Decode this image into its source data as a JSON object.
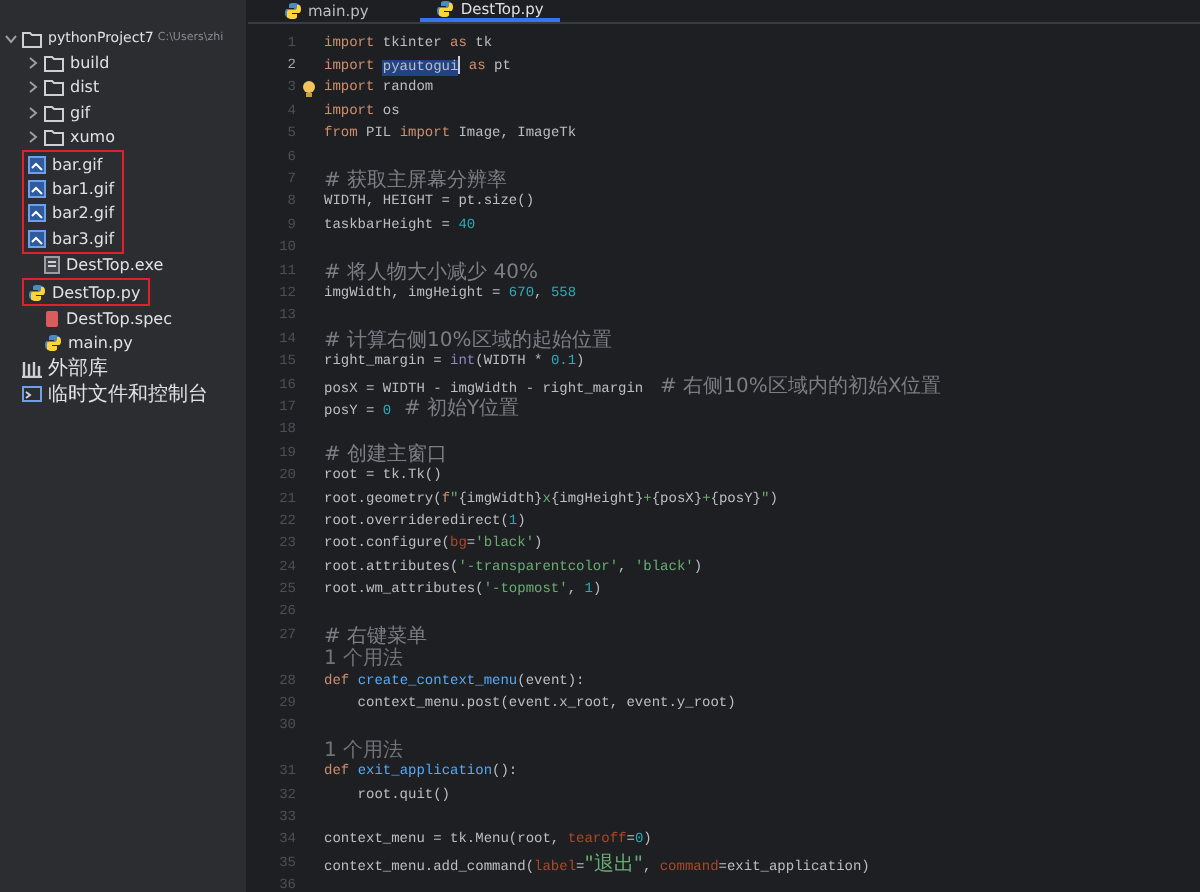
{
  "sidebar": {
    "tree": [
      {
        "kind": "project",
        "label": "pythonProject7",
        "path": "C:\\Users\\zhi",
        "expanded": true,
        "children": [
          {
            "kind": "folder",
            "label": "build",
            "expanded": false
          },
          {
            "kind": "folder",
            "label": "dist",
            "expanded": false
          },
          {
            "kind": "folder",
            "label": "gif",
            "expanded": false
          },
          {
            "kind": "folder",
            "label": "xumo",
            "expanded": false
          },
          {
            "kind": "highlight-box",
            "children": [
              {
                "kind": "gif",
                "label": "bar.gif"
              },
              {
                "kind": "gif",
                "label": "bar1.gif"
              },
              {
                "kind": "gif",
                "label": "bar2.gif"
              },
              {
                "kind": "gif",
                "label": "bar3.gif"
              }
            ]
          },
          {
            "kind": "exe",
            "label": "DestTop.exe"
          },
          {
            "kind": "highlight-box",
            "children": [
              {
                "kind": "python",
                "label": "DestTop.py"
              }
            ]
          },
          {
            "kind": "spec",
            "label": "DestTop.spec"
          },
          {
            "kind": "python",
            "label": "main.py"
          }
        ]
      },
      {
        "kind": "libraries",
        "label": "外部库"
      },
      {
        "kind": "scratches",
        "label": "临时文件和控制台"
      }
    ]
  },
  "tabs": [
    {
      "label": "main.py",
      "selected": false
    },
    {
      "label": "DestTop.py",
      "selected": true
    }
  ],
  "editor": {
    "lines": [
      {
        "kind": "code",
        "number": "1",
        "current": false,
        "tokens": [
          {
            "kind": "keyword",
            "text": "import "
          },
          {
            "kind": "plain",
            "text": "tkinter "
          },
          {
            "kind": "keyword",
            "text": "as "
          },
          {
            "kind": "plain",
            "text": "tk"
          }
        ]
      },
      {
        "kind": "code",
        "number": "2",
        "current": true,
        "tokens": [
          {
            "kind": "keyword",
            "text": "import "
          },
          {
            "kind": "selected",
            "text": "pyautogui"
          },
          {
            "kind": "keyword",
            "text": " as "
          },
          {
            "kind": "plain",
            "text": "pt"
          }
        ]
      },
      {
        "kind": "code",
        "number": "3",
        "current": false,
        "bulb": true,
        "tokens": [
          {
            "kind": "keyword",
            "text": "import "
          },
          {
            "kind": "plain",
            "text": "random"
          }
        ]
      },
      {
        "kind": "code",
        "number": "4",
        "current": false,
        "tokens": [
          {
            "kind": "keyword",
            "text": "import "
          },
          {
            "kind": "plain",
            "text": "os"
          }
        ]
      },
      {
        "kind": "code",
        "number": "5",
        "current": false,
        "tokens": [
          {
            "kind": "keyword",
            "text": "from "
          },
          {
            "kind": "plain",
            "text": "PIL "
          },
          {
            "kind": "keyword",
            "text": "import "
          },
          {
            "kind": "plain",
            "text": "Image, ImageTk"
          }
        ]
      },
      {
        "kind": "code",
        "number": "6",
        "current": false
      },
      {
        "kind": "code",
        "number": "7",
        "current": false,
        "tokens": [
          {
            "kind": "comment",
            "text": "# 获取主屏幕分辨率"
          }
        ]
      },
      {
        "kind": "code",
        "number": "8",
        "current": false,
        "tokens": [
          {
            "kind": "plain",
            "text": "WIDTH, HEIGHT = pt.size()"
          }
        ]
      },
      {
        "kind": "code",
        "number": "9",
        "current": false,
        "tokens": [
          {
            "kind": "plain",
            "text": "taskbarHeight = "
          },
          {
            "kind": "number",
            "text": "40"
          }
        ]
      },
      {
        "kind": "code",
        "number": "10",
        "current": false
      },
      {
        "kind": "code",
        "number": "11",
        "current": false,
        "tokens": [
          {
            "kind": "comment",
            "text": "# 将人物大小减少 40%"
          }
        ]
      },
      {
        "kind": "code",
        "number": "12",
        "current": false,
        "tokens": [
          {
            "kind": "plain",
            "text": "imgWidth, imgHeight = "
          },
          {
            "kind": "number",
            "text": "670"
          },
          {
            "kind": "plain",
            "text": ", "
          },
          {
            "kind": "number",
            "text": "558"
          }
        ]
      },
      {
        "kind": "code",
        "number": "13",
        "current": false
      },
      {
        "kind": "code",
        "number": "14",
        "current": false,
        "tokens": [
          {
            "kind": "comment",
            "text": "# 计算右侧10%区域的起始位置"
          }
        ]
      },
      {
        "kind": "code",
        "number": "15",
        "current": false,
        "tokens": [
          {
            "kind": "plain",
            "text": "right_margin = "
          },
          {
            "kind": "builtin",
            "text": "int"
          },
          {
            "kind": "plain",
            "text": "(WIDTH * "
          },
          {
            "kind": "number",
            "text": "0.1"
          },
          {
            "kind": "plain",
            "text": ")"
          }
        ]
      },
      {
        "kind": "code",
        "number": "16",
        "current": false,
        "tokens": [
          {
            "kind": "plain",
            "text": "posX = WIDTH - imgWidth - right_margin  "
          },
          {
            "kind": "comment",
            "text": "# 右侧10%区域内的初始X位置"
          }
        ]
      },
      {
        "kind": "code",
        "number": "17",
        "current": false,
        "tokens": [
          {
            "kind": "plain",
            "text": "posY = "
          },
          {
            "kind": "number",
            "text": "0"
          },
          {
            "kind": "comment",
            "text": "  # 初始Y位置"
          }
        ]
      },
      {
        "kind": "code",
        "number": "18",
        "current": false
      },
      {
        "kind": "code",
        "number": "19",
        "current": false,
        "tokens": [
          {
            "kind": "comment",
            "text": "# 创建主窗口"
          }
        ]
      },
      {
        "kind": "code",
        "number": "20",
        "current": false,
        "tokens": [
          {
            "kind": "plain",
            "text": "root = tk.Tk()"
          }
        ]
      },
      {
        "kind": "code",
        "number": "21",
        "current": false,
        "tokens": [
          {
            "kind": "plain",
            "text": "root.geometry("
          },
          {
            "kind": "keyword",
            "text": "f"
          },
          {
            "kind": "string",
            "text": "\""
          },
          {
            "kind": "plain",
            "text": "{imgWidth}"
          },
          {
            "kind": "string",
            "text": "x"
          },
          {
            "kind": "plain",
            "text": "{imgHeight}"
          },
          {
            "kind": "string",
            "text": "+"
          },
          {
            "kind": "plain",
            "text": "{posX}"
          },
          {
            "kind": "string",
            "text": "+"
          },
          {
            "kind": "plain",
            "text": "{posY}"
          },
          {
            "kind": "string",
            "text": "\""
          },
          {
            "kind": "plain",
            "text": ")"
          }
        ]
      },
      {
        "kind": "code",
        "number": "22",
        "current": false,
        "tokens": [
          {
            "kind": "plain",
            "text": "root.overrideredirect("
          },
          {
            "kind": "number",
            "text": "1"
          },
          {
            "kind": "plain",
            "text": ")"
          }
        ]
      },
      {
        "kind": "code",
        "number": "23",
        "current": false,
        "tokens": [
          {
            "kind": "plain",
            "text": "root.configure("
          },
          {
            "kind": "param",
            "text": "bg"
          },
          {
            "kind": "plain",
            "text": "="
          },
          {
            "kind": "string",
            "text": "'black'"
          },
          {
            "kind": "plain",
            "text": ")"
          }
        ]
      },
      {
        "kind": "code",
        "number": "24",
        "current": false,
        "tokens": [
          {
            "kind": "plain",
            "text": "root.attributes("
          },
          {
            "kind": "string",
            "text": "'-transparentcolor'"
          },
          {
            "kind": "plain",
            "text": ", "
          },
          {
            "kind": "string",
            "text": "'black'"
          },
          {
            "kind": "plain",
            "text": ")"
          }
        ]
      },
      {
        "kind": "code",
        "number": "25",
        "current": false,
        "tokens": [
          {
            "kind": "plain",
            "text": "root.wm_attributes("
          },
          {
            "kind": "string",
            "text": "'-topmost'"
          },
          {
            "kind": "plain",
            "text": ", "
          },
          {
            "kind": "number",
            "text": "1"
          },
          {
            "kind": "plain",
            "text": ")"
          }
        ]
      },
      {
        "kind": "code",
        "number": "26",
        "current": false
      },
      {
        "kind": "code",
        "number": "27",
        "current": false,
        "tokens": [
          {
            "kind": "comment",
            "text": "# 右键菜单"
          }
        ]
      },
      {
        "kind": "hint",
        "text": "1 个用法"
      },
      {
        "kind": "code",
        "number": "28",
        "current": false,
        "tokens": [
          {
            "kind": "keyword",
            "text": "def "
          },
          {
            "kind": "funcdef",
            "text": "create_context_menu"
          },
          {
            "kind": "plain",
            "text": "(event):"
          }
        ]
      },
      {
        "kind": "code",
        "number": "29",
        "current": false,
        "tokens": [
          {
            "kind": "plain",
            "text": "    context_menu.post(event.x_root, event.y_root)"
          }
        ]
      },
      {
        "kind": "code",
        "number": "30",
        "current": false
      },
      {
        "kind": "hint",
        "text": "1 个用法"
      },
      {
        "kind": "code",
        "number": "31",
        "current": false,
        "tokens": [
          {
            "kind": "keyword",
            "text": "def "
          },
          {
            "kind": "funcdef",
            "text": "exit_application"
          },
          {
            "kind": "plain",
            "text": "():"
          }
        ]
      },
      {
        "kind": "code",
        "number": "32",
        "current": false,
        "tokens": [
          {
            "kind": "plain",
            "text": "    root.quit()"
          }
        ]
      },
      {
        "kind": "code",
        "number": "33",
        "current": false
      },
      {
        "kind": "code",
        "number": "34",
        "current": false,
        "tokens": [
          {
            "kind": "plain",
            "text": "context_menu = tk.Menu(root, "
          },
          {
            "kind": "param",
            "text": "tearoff"
          },
          {
            "kind": "plain",
            "text": "="
          },
          {
            "kind": "number",
            "text": "0"
          },
          {
            "kind": "plain",
            "text": ")"
          }
        ]
      },
      {
        "kind": "code",
        "number": "35",
        "current": false,
        "tokens": [
          {
            "kind": "plain",
            "text": "context_menu.add_command("
          },
          {
            "kind": "param",
            "text": "label"
          },
          {
            "kind": "plain",
            "text": "="
          },
          {
            "kind": "string",
            "text": "\"退出\""
          },
          {
            "kind": "plain",
            "text": ", "
          },
          {
            "kind": "param",
            "text": "command"
          },
          {
            "kind": "plain",
            "text": "=exit_application)"
          }
        ]
      },
      {
        "kind": "code",
        "number": "36",
        "current": false
      }
    ]
  }
}
